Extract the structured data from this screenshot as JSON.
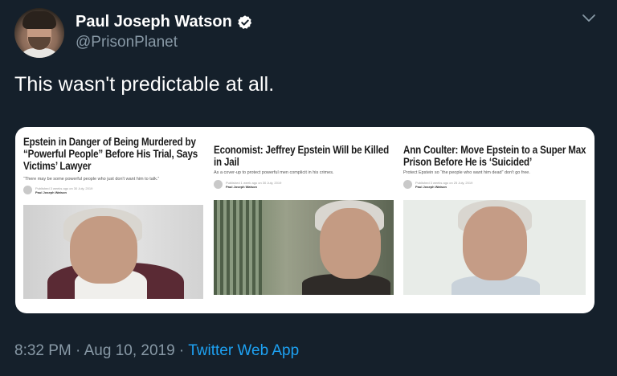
{
  "author": {
    "name": "Paul Joseph Watson",
    "handle": "@PrisonPlanet"
  },
  "tweet": {
    "text": "This wasn't predictable at all."
  },
  "card": {
    "articles": [
      {
        "headline": "Epstein in Danger of Being Murdered by “Powerful People” Before His Trial, Says Victims’ Lawyer",
        "subheadline": "“There may be some powerful people who just don't want him to talk.”",
        "published": "Published 3 weeks ago on 30 July, 2019",
        "byline": "Paul Joseph Watson"
      },
      {
        "headline": "Economist: Jeffrey Epstein Will be Killed in Jail",
        "subheadline": "As a cover-up to protect powerful men complicit in his crimes.",
        "published": "Published 1 week ago on 30 July, 2019",
        "byline": "Paul Joseph Watson"
      },
      {
        "headline": "Ann Coulter: Move Epstein to a Super Max Prison Before He is ‘Suicided’",
        "subheadline": "Protect Epstein so “the people who want him dead” don't go free.",
        "published": "Published 3 weeks ago on 25 July, 2019",
        "byline": "Paul Joseph Watson"
      }
    ]
  },
  "footer": {
    "time": "8:32 PM",
    "separator": " · ",
    "date": "Aug 10, 2019",
    "source": "Twitter Web App"
  },
  "icons": {
    "verified": "verified-badge-icon",
    "more": "chevron-down-icon"
  },
  "colors": {
    "background": "#15202b",
    "secondary_text": "#8899a6",
    "link": "#1da1f2"
  }
}
